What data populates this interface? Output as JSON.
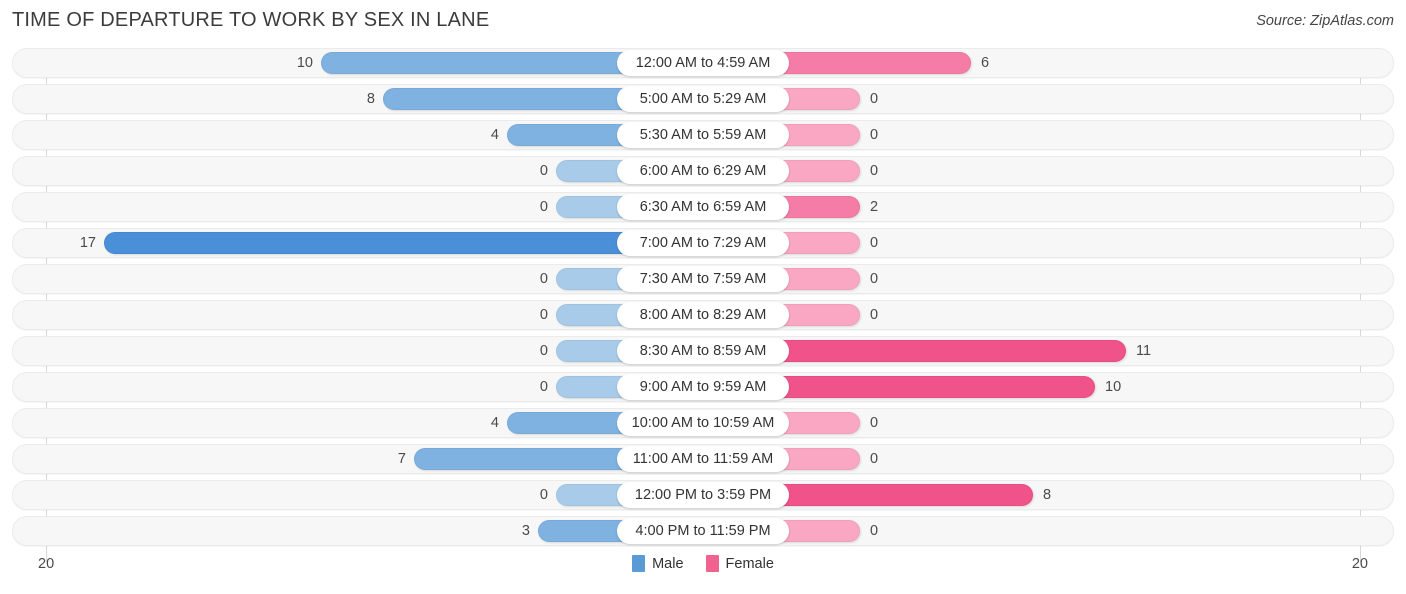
{
  "header": {
    "title": "TIME OF DEPARTURE TO WORK BY SEX IN LANE",
    "source": "Source: ZipAtlas.com"
  },
  "legend": {
    "items": [
      {
        "label": "Male",
        "color": "#5b9bd5"
      },
      {
        "label": "Female",
        "color": "#f0628f"
      }
    ]
  },
  "axis": {
    "left_max": "20",
    "right_max": "20"
  },
  "chart_data": {
    "type": "bar",
    "orientation": "horizontal-diverging",
    "title": "TIME OF DEPARTURE TO WORK BY SEX IN LANE",
    "xlabel": "",
    "ylabel": "",
    "axis_max": 20,
    "grid": false,
    "legend_position": "bottom-center",
    "categories": [
      "12:00 AM to 4:59 AM",
      "5:00 AM to 5:29 AM",
      "5:30 AM to 5:59 AM",
      "6:00 AM to 6:29 AM",
      "6:30 AM to 6:59 AM",
      "7:00 AM to 7:29 AM",
      "7:30 AM to 7:59 AM",
      "8:00 AM to 8:29 AM",
      "8:30 AM to 8:59 AM",
      "9:00 AM to 9:59 AM",
      "10:00 AM to 10:59 AM",
      "11:00 AM to 11:59 AM",
      "12:00 PM to 3:59 PM",
      "4:00 PM to 11:59 PM"
    ],
    "series": [
      {
        "name": "Male",
        "color": "#5b9bd5",
        "values": [
          10,
          8,
          4,
          0,
          0,
          17,
          0,
          0,
          0,
          0,
          4,
          7,
          0,
          3
        ]
      },
      {
        "name": "Female",
        "color": "#f0628f",
        "values": [
          6,
          0,
          0,
          0,
          2,
          0,
          0,
          0,
          11,
          10,
          0,
          0,
          8,
          0
        ]
      }
    ]
  }
}
